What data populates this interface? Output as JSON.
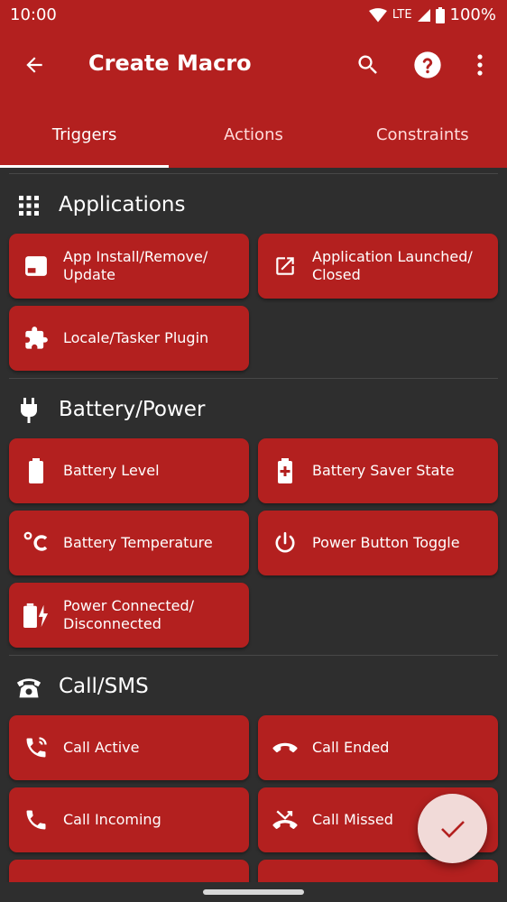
{
  "status_bar": {
    "time": "10:00",
    "network": "LTE",
    "battery": "100%"
  },
  "toolbar": {
    "title": "Create Macro"
  },
  "tabs": [
    {
      "label": "Triggers",
      "active": true
    },
    {
      "label": "Actions",
      "active": false
    },
    {
      "label": "Constraints",
      "active": false
    }
  ],
  "sections": [
    {
      "title": "Applications",
      "icon": "apps-grid-icon",
      "items": [
        {
          "label": "App Install/Remove/\nUpdate",
          "icon": "app-window-icon"
        },
        {
          "label": "Application Launched/\nClosed",
          "icon": "open-in-new-icon"
        },
        {
          "label": "Locale/Tasker Plugin",
          "icon": "puzzle-icon"
        }
      ]
    },
    {
      "title": "Battery/Power",
      "icon": "power-plug-icon",
      "items": [
        {
          "label": "Battery Level",
          "icon": "battery-icon"
        },
        {
          "label": "Battery Saver State",
          "icon": "battery-plus-icon"
        },
        {
          "label": "Battery Temperature",
          "icon": "celsius-icon"
        },
        {
          "label": "Power Button Toggle",
          "icon": "power-icon"
        },
        {
          "label": "Power Connected/\nDisconnected",
          "icon": "battery-charging-icon"
        }
      ]
    },
    {
      "title": "Call/SMS",
      "icon": "telephone-icon",
      "items": [
        {
          "label": "Call Active",
          "icon": "phone-in-talk-icon"
        },
        {
          "label": "Call Ended",
          "icon": "call-end-icon"
        },
        {
          "label": "Call Incoming",
          "icon": "phone-icon"
        },
        {
          "label": "Call Missed",
          "icon": "call-missed-icon"
        }
      ]
    }
  ],
  "colors": {
    "primary": "#b3201f",
    "background": "#2e2e2e",
    "fab": "#f1dad8"
  }
}
